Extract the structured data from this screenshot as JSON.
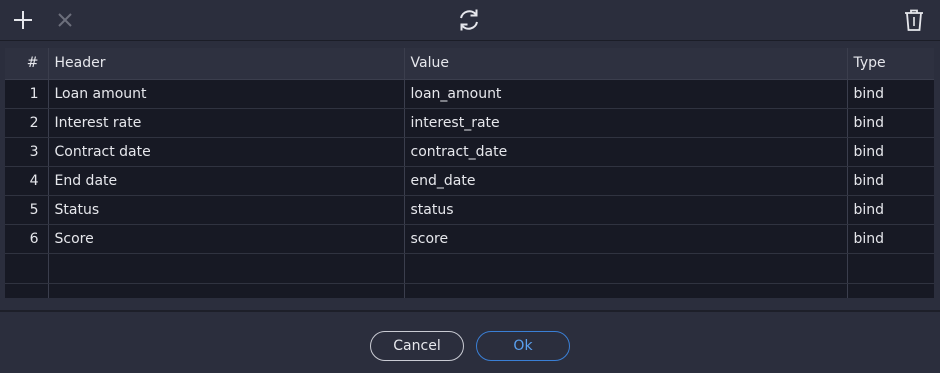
{
  "toolbar": {
    "add_icon": "plus-icon",
    "remove_icon": "close-icon",
    "refresh_icon": "refresh-icon",
    "delete_icon": "trash-icon"
  },
  "grid": {
    "columns": {
      "num": "#",
      "header": "Header",
      "value": "Value",
      "type": "Type"
    },
    "rows": [
      {
        "num": "1",
        "header": "Loan amount",
        "value": "loan_amount",
        "type": "bind"
      },
      {
        "num": "2",
        "header": "Interest rate",
        "value": "interest_rate",
        "type": "bind"
      },
      {
        "num": "3",
        "header": "Contract date",
        "value": "contract_date",
        "type": "bind"
      },
      {
        "num": "4",
        "header": "End date",
        "value": "end_date",
        "type": "bind"
      },
      {
        "num": "5",
        "header": "Status",
        "value": "status",
        "type": "bind"
      },
      {
        "num": "6",
        "header": "Score",
        "value": "score",
        "type": "bind"
      }
    ]
  },
  "footer": {
    "cancel_label": "Cancel",
    "ok_label": "Ok"
  },
  "colors": {
    "accent": "#3a7fd5",
    "background": "#2b2e3d",
    "cell": "#171924"
  }
}
